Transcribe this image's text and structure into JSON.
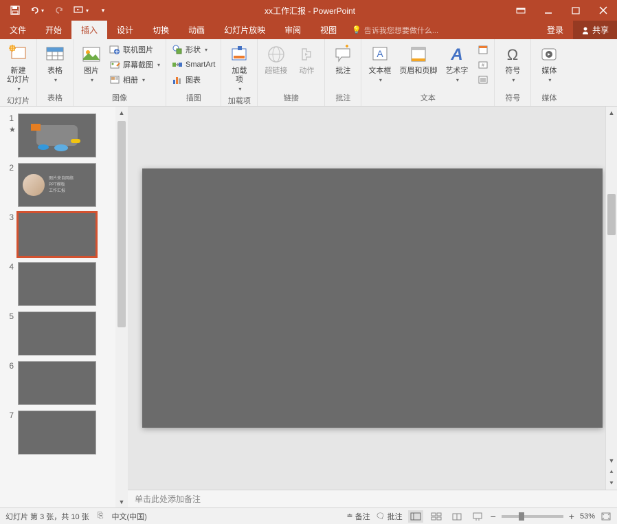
{
  "titlebar": {
    "title": "xx工作汇报 - PowerPoint"
  },
  "menu": {
    "tabs": [
      "文件",
      "开始",
      "插入",
      "设计",
      "切换",
      "动画",
      "幻灯片放映",
      "审阅",
      "视图"
    ],
    "active_index": 2,
    "tellme": "告诉我您想要做什么...",
    "login": "登录",
    "share": "共享"
  },
  "ribbon": {
    "groups": {
      "slides": {
        "label": "幻灯片",
        "new_slide": "新建\n幻灯片"
      },
      "tables": {
        "label": "表格",
        "tables_btn": "表格"
      },
      "images": {
        "label": "图像",
        "picture": "图片",
        "online_pic": "联机图片",
        "screenshot": "屏幕截图",
        "album": "相册"
      },
      "illustrations": {
        "label": "插图",
        "shapes": "形状",
        "smartart": "SmartArt",
        "chart": "图表"
      },
      "addins": {
        "label": "加载项",
        "addin": "加载\n项"
      },
      "links": {
        "label": "链接",
        "hyperlink": "超链接",
        "action": "动作"
      },
      "comments": {
        "label": "批注",
        "comment": "批注"
      },
      "text": {
        "label": "文本",
        "textbox": "文本框",
        "header_footer": "页眉和页脚",
        "wordart": "艺术字"
      },
      "symbols": {
        "label": "符号",
        "symbol": "符号"
      },
      "media": {
        "label": "媒体",
        "media_btn": "媒体"
      }
    }
  },
  "thumbnails": {
    "slides": [
      1,
      2,
      3,
      4,
      5,
      6,
      7
    ],
    "selected": 3
  },
  "notes": {
    "placeholder": "单击此处添加备注"
  },
  "status": {
    "slide_info": "幻灯片 第 3 张，共 10 张",
    "language": "中文(中国)",
    "notes_btn": "备注",
    "comments_btn": "批注",
    "zoom": "53%"
  }
}
